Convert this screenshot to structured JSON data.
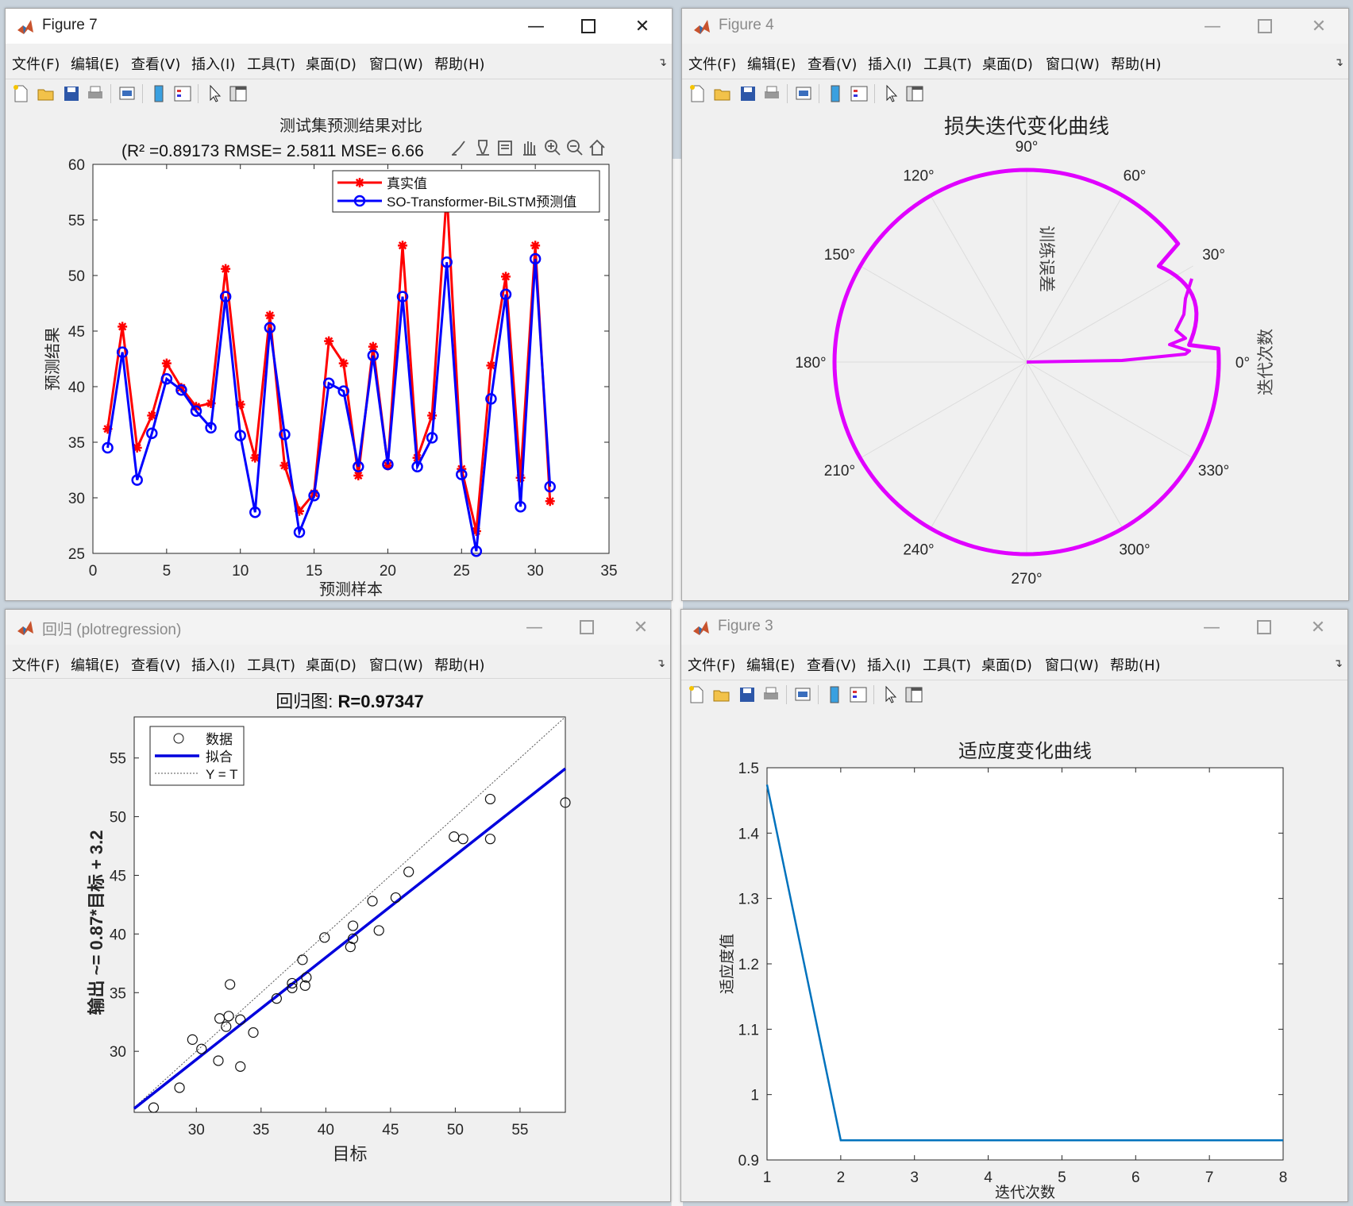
{
  "menus": [
    "文件(F)",
    "编辑(E)",
    "查看(V)",
    "插入(I)",
    "工具(T)",
    "桌面(D)",
    "窗口(W)",
    "帮助(H)"
  ],
  "windows": {
    "fig7": {
      "title": "Figure 7",
      "chart_data": {
        "type": "line",
        "title": "测试集预测结果对比",
        "subtitle": "(R² =0.89173 RMSE= 2.5811 MSE= 6.66",
        "xlabel": "预测样本",
        "ylabel": "预测结果",
        "xlim": [
          0,
          35
        ],
        "ylim": [
          25,
          60
        ],
        "xticks": [
          0,
          5,
          10,
          15,
          20,
          25,
          30,
          35
        ],
        "yticks": [
          25,
          30,
          35,
          40,
          45,
          50,
          55,
          60
        ],
        "legend_position": "top-right",
        "x": [
          1,
          2,
          3,
          4,
          5,
          6,
          7,
          8,
          9,
          10,
          11,
          12,
          13,
          14,
          15,
          16,
          17,
          18,
          19,
          20,
          21,
          22,
          23,
          24,
          25,
          26,
          27,
          28,
          29,
          30,
          31
        ],
        "series": [
          {
            "name": "真实值",
            "color": "#ff0000",
            "marker": "star",
            "values": [
              36.2,
              45.4,
              34.5,
              37.4,
              42.1,
              39.9,
              38.2,
              38.5,
              50.6,
              38.4,
              33.6,
              46.4,
              32.9,
              28.8,
              30.4,
              44.1,
              42.1,
              32.0,
              43.6,
              32.9,
              52.7,
              33.6,
              37.4,
              57.5,
              32.6,
              27.0,
              41.9,
              49.9,
              31.8,
              52.7,
              29.7
            ]
          },
          {
            "name": "SO-Transformer-BiLSTM预测值",
            "color": "#0000ff",
            "marker": "circle",
            "values": [
              34.5,
              43.1,
              31.6,
              35.8,
              40.7,
              39.7,
              37.8,
              36.3,
              48.1,
              35.6,
              28.7,
              45.3,
              35.7,
              26.9,
              30.2,
              40.3,
              39.6,
              32.8,
              42.8,
              33.0,
              48.1,
              32.8,
              35.4,
              51.2,
              32.1,
              25.2,
              38.9,
              48.3,
              29.2,
              51.5,
              31.0
            ]
          }
        ]
      }
    },
    "fig4": {
      "title": "Figure 4",
      "chart_data": {
        "type": "polar",
        "title": "损失迭代变化曲线",
        "rlabel": "训练误差",
        "thetalabel": "迭代次数",
        "angle_labels": [
          "0°",
          "30°",
          "60°",
          "90°",
          "120°",
          "150°",
          "180°",
          "210°",
          "240°",
          "270°",
          "300°",
          "330°"
        ],
        "color": "#e000ff"
      }
    },
    "reg": {
      "title": "回归 (plotregression)",
      "chart_data": {
        "type": "scatter",
        "title_prefix": "回归图: ",
        "title_value": "R=0.97347",
        "xlabel": "目标",
        "ylabel": "输出 ~= 0.87*目标 + 3.2",
        "xlim": [
          25.2,
          58.5
        ],
        "ylim": [
          24.8,
          58.5
        ],
        "xticks": [
          30,
          35,
          40,
          45,
          50,
          55
        ],
        "yticks": [
          30,
          35,
          40,
          45,
          50,
          55
        ],
        "legend": [
          "数据",
          "拟合",
          "Y = T"
        ],
        "legend_position": "top-left",
        "fit": {
          "slope": 0.87,
          "intercept": 3.2
        },
        "points": [
          [
            26.7,
            25.2
          ],
          [
            28.7,
            26.9
          ],
          [
            29.7,
            31.0
          ],
          [
            30.4,
            30.2
          ],
          [
            31.7,
            29.2
          ],
          [
            31.8,
            32.8
          ],
          [
            32.3,
            32.1
          ],
          [
            32.5,
            33.0
          ],
          [
            32.6,
            35.7
          ],
          [
            33.4,
            28.7
          ],
          [
            33.4,
            32.7
          ],
          [
            34.4,
            31.6
          ],
          [
            36.2,
            34.5
          ],
          [
            37.4,
            35.4
          ],
          [
            37.4,
            35.8
          ],
          [
            38.2,
            37.8
          ],
          [
            38.4,
            35.6
          ],
          [
            38.5,
            36.3
          ],
          [
            39.9,
            39.7
          ],
          [
            41.9,
            38.9
          ],
          [
            42.1,
            39.6
          ],
          [
            42.1,
            40.7
          ],
          [
            43.6,
            42.8
          ],
          [
            44.1,
            40.3
          ],
          [
            45.4,
            43.1
          ],
          [
            46.4,
            45.3
          ],
          [
            49.9,
            48.3
          ],
          [
            50.6,
            48.1
          ],
          [
            52.7,
            48.1
          ],
          [
            52.7,
            51.5
          ],
          [
            58.5,
            51.2
          ]
        ]
      }
    },
    "fig3": {
      "title": "Figure 3",
      "chart_data": {
        "type": "line",
        "title": "适应度变化曲线",
        "xlabel": "迭代次数",
        "ylabel": "适应度值",
        "xlim": [
          1,
          8
        ],
        "ylim": [
          0.9,
          1.5
        ],
        "xticks": [
          1,
          2,
          3,
          4,
          5,
          6,
          7,
          8
        ],
        "yticks": [
          0.9,
          1,
          1.1,
          1.2,
          1.3,
          1.4,
          1.5
        ],
        "x": [
          1,
          2,
          3,
          4,
          5,
          6,
          7,
          8
        ],
        "series": [
          {
            "color": "#0072bd",
            "values": [
              1.474,
              0.93,
              0.93,
              0.93,
              0.93,
              0.93,
              0.93,
              0.93
            ]
          }
        ]
      }
    }
  }
}
